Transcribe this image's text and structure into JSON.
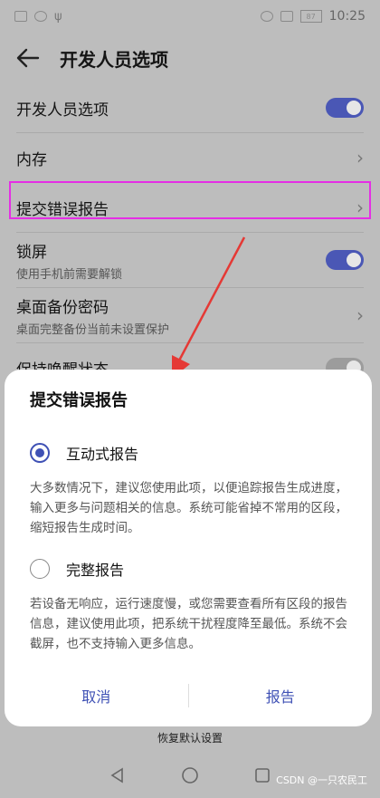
{
  "status_bar": {
    "time": "10:25",
    "battery": "87",
    "icons": [
      "sim-icon",
      "wifi-icon",
      "usb-icon",
      "eye-icon",
      "vibrate-icon",
      "battery-icon"
    ]
  },
  "header": {
    "title": "开发人员选项"
  },
  "settings": {
    "items": [
      {
        "label": "开发人员选项",
        "sub": "",
        "control": "toggle-on"
      },
      {
        "label": "内存",
        "sub": "",
        "control": "chevron"
      },
      {
        "label": "提交错误报告",
        "sub": "",
        "control": "chevron"
      },
      {
        "label": "锁屏",
        "sub": "使用手机前需要解锁",
        "control": "toggle-on"
      },
      {
        "label": "桌面备份密码",
        "sub": "桌面完整备份当前未设置保护",
        "control": "chevron"
      },
      {
        "label": "保持唤醒状态",
        "sub": "",
        "control": "toggle-off"
      }
    ]
  },
  "dialog": {
    "title": "提交错误报告",
    "options": [
      {
        "label": "互动式报告",
        "selected": true,
        "desc": "大多数情况下，建议您使用此项，以便追踪报告生成进度，输入更多与问题相关的信息。系统可能省掉不常用的区段，缩短报告生成时间。"
      },
      {
        "label": "完整报告",
        "selected": false,
        "desc": "若设备无响应，运行速度慢，或您需要查看所有区段的报告信息，建议使用此项，把系统干扰程度降至最低。系统不会截屏，也不支持输入更多信息。"
      }
    ],
    "cancel_label": "取消",
    "report_label": "报告"
  },
  "footer": {
    "restore_label": "恢复默认设置"
  },
  "watermark": "CSDN @一只农民工",
  "colors": {
    "accent": "#3f51b5",
    "highlight": "#e52ee5",
    "arrow": "#e53935"
  }
}
